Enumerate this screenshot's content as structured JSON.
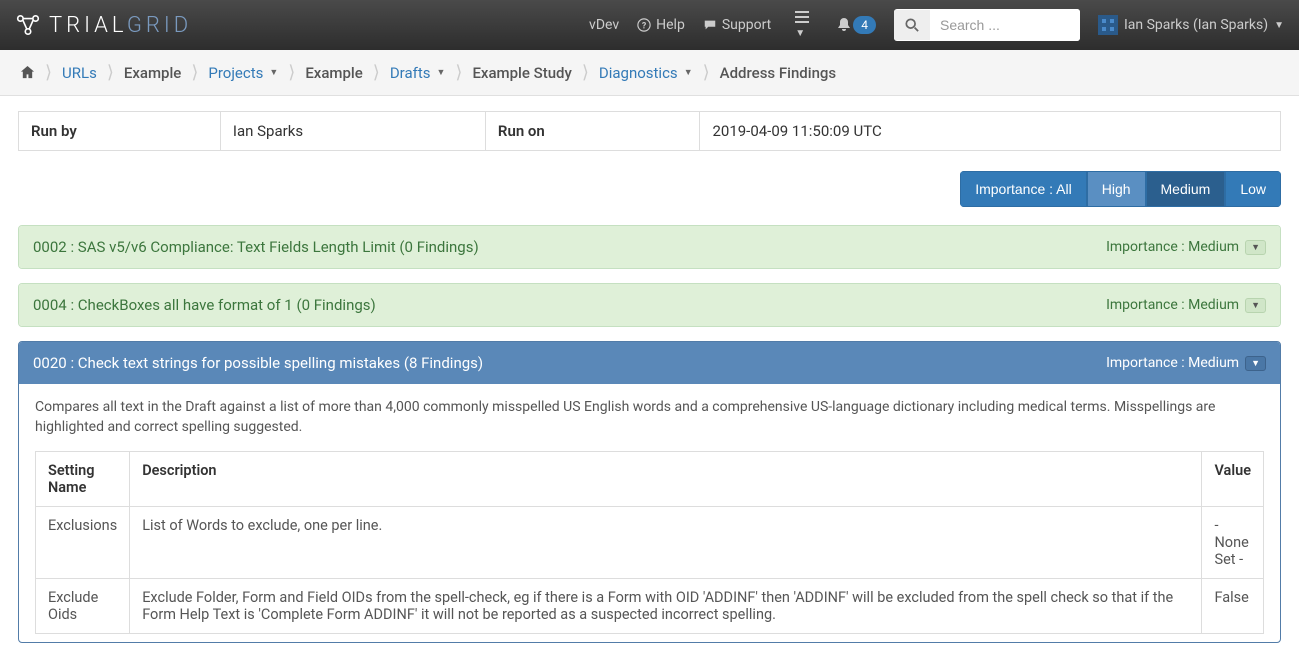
{
  "navbar": {
    "logo_trial": "TRIAL",
    "logo_grid": "GRID",
    "vdev": "vDev",
    "help": "Help",
    "support": "Support",
    "bell_count": "4",
    "search_placeholder": "Search ...",
    "user_name": "Ian Sparks (Ian Sparks)"
  },
  "breadcrumb": {
    "urls": "URLs",
    "org": "Example",
    "projects": "Projects",
    "project": "Example",
    "drafts": "Drafts",
    "study": "Example Study",
    "diagnostics": "Diagnostics",
    "current": "Address Findings"
  },
  "run_info": {
    "run_by_label": "Run by",
    "run_by_value": "Ian Sparks",
    "run_on_label": "Run on",
    "run_on_value": "2019-04-09 11:50:09 UTC"
  },
  "filters": {
    "all": "Importance : All",
    "high": "High",
    "medium": "Medium",
    "low": "Low"
  },
  "panels": {
    "p1": {
      "title": "0002 : SAS v5/v6 Compliance: Text Fields Length Limit (0 Findings)",
      "importance": "Importance : Medium"
    },
    "p2": {
      "title": "0004 : CheckBoxes all have format of 1 (0 Findings)",
      "importance": "Importance : Medium"
    },
    "p3": {
      "title": "0020 : Check text strings for possible spelling mistakes (8 Findings)",
      "importance": "Importance : Medium",
      "desc": "Compares all text in the Draft against a list of more than 4,000 commonly misspelled US English words and a comprehensive US-language dictionary including medical terms. Misspellings are highlighted and correct spelling suggested."
    }
  },
  "settings": {
    "col_name": "Setting Name",
    "col_desc": "Description",
    "col_value": "Value",
    "rows": [
      {
        "name": "Exclusions",
        "desc": "List of Words to exclude, one per line.",
        "value": "- None Set -"
      },
      {
        "name": "Exclude Oids",
        "desc": "Exclude Folder, Form and Field OIDs from the spell-check, eg if there is a Form with OID 'ADDINF' then 'ADDINF' will be excluded from the spell check so that if the Form Help Text is 'Complete Form ADDINF' it will not be reported as a suspected incorrect spelling.",
        "value": "False"
      }
    ]
  }
}
